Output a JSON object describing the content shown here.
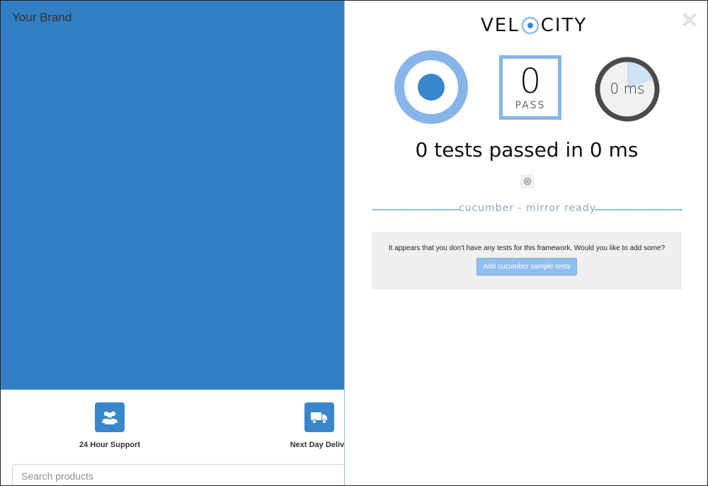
{
  "app": {
    "brand": "Your Brand",
    "features": [
      {
        "label": "24 Hour Support",
        "icon": "users-icon"
      },
      {
        "label": "Next Day Delive",
        "icon": "truck-icon"
      }
    ],
    "search": {
      "placeholder": "Search products",
      "value": ""
    }
  },
  "velocity": {
    "logo_left": "VEL",
    "logo_right": "CITY",
    "pass_count": "0",
    "pass_label": "PASS",
    "timer_text": "0 ms",
    "summary": "0 tests passed in 0 ms",
    "framework_status": "cucumber - mirror ready",
    "notice_message": "It appears that you don't have any tests for this framework. Would you like to add some?",
    "add_button_label": "Add cucumber sample tests"
  },
  "colors": {
    "hero_blue": "#3180c6",
    "accent_light": "#88b5e8",
    "accent_dark": "#3a86cc"
  }
}
